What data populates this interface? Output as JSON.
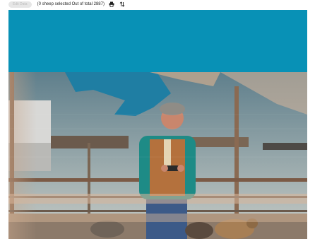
{
  "toolbar": {
    "edit_label": "Edit Data",
    "selection_text": "(0 sheep selected Out of total 2887)",
    "print_icon": "print-icon",
    "sort_icon": "sort-icon"
  },
  "banner": {
    "color": "#0891b6"
  },
  "photo": {
    "subject": "farmer-with-phone-in-sheep-pen"
  }
}
